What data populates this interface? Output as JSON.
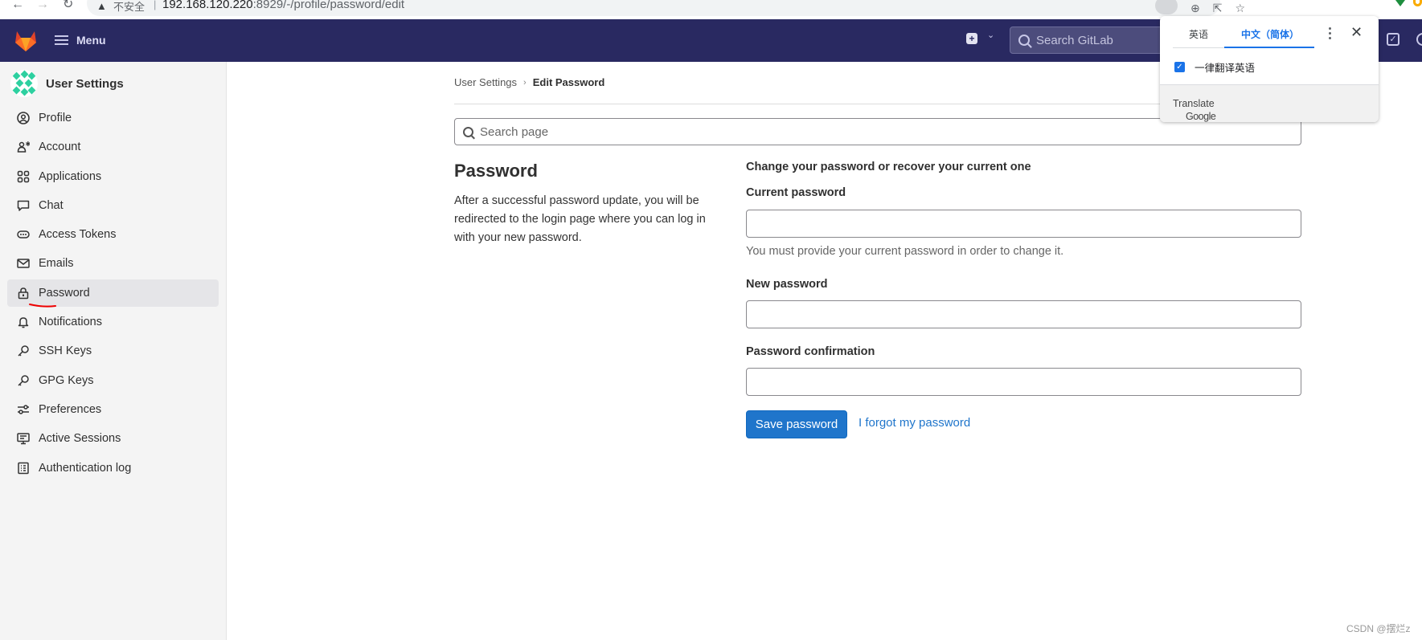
{
  "browser": {
    "security_label": "不安全",
    "url_host": "192.168.120.220",
    "url_path": ":8929/-/profile/password/edit"
  },
  "topnav": {
    "menu_label": "Menu",
    "search_placeholder": "Search GitLab"
  },
  "sidebar": {
    "title": "User Settings",
    "items": [
      {
        "label": "Profile",
        "icon": "profile-icon"
      },
      {
        "label": "Account",
        "icon": "account-icon"
      },
      {
        "label": "Applications",
        "icon": "applications-icon"
      },
      {
        "label": "Chat",
        "icon": "chat-icon"
      },
      {
        "label": "Access Tokens",
        "icon": "token-icon"
      },
      {
        "label": "Emails",
        "icon": "mail-icon"
      },
      {
        "label": "Password",
        "icon": "lock-icon",
        "active": true
      },
      {
        "label": "Notifications",
        "icon": "bell-icon"
      },
      {
        "label": "SSH Keys",
        "icon": "key-icon"
      },
      {
        "label": "GPG Keys",
        "icon": "key-icon"
      },
      {
        "label": "Preferences",
        "icon": "preferences-icon"
      },
      {
        "label": "Active Sessions",
        "icon": "monitor-icon"
      },
      {
        "label": "Authentication log",
        "icon": "log-icon"
      }
    ]
  },
  "breadcrumb": {
    "parent": "User Settings",
    "current": "Edit Password"
  },
  "page_search": {
    "placeholder": "Search page"
  },
  "section": {
    "title": "Password",
    "description": "After a successful password update, you will be redirected to the login page where you can log in with your new password."
  },
  "form": {
    "intro": "Change your password or recover your current one",
    "current_label": "Current password",
    "current_value": "",
    "current_help": "You must provide your current password in order to change it.",
    "new_label": "New password",
    "new_value": "",
    "confirm_label": "Password confirmation",
    "confirm_value": "",
    "save_label": "Save password",
    "forgot_label": "I forgot my password"
  },
  "translate_popup": {
    "tab_source": "英语",
    "tab_target": "中文（简体）",
    "always_translate_label": "一律翻译英语",
    "always_translate_checked": true,
    "footer_google": "Google",
    "footer_translate": "Translate"
  },
  "watermark": "CSDN @摆烂z",
  "colors": {
    "nav_bg": "#292961",
    "primary": "#1f75cb",
    "sidebar_bg": "#f4f4f4",
    "translate_blue": "#1a73e8"
  }
}
